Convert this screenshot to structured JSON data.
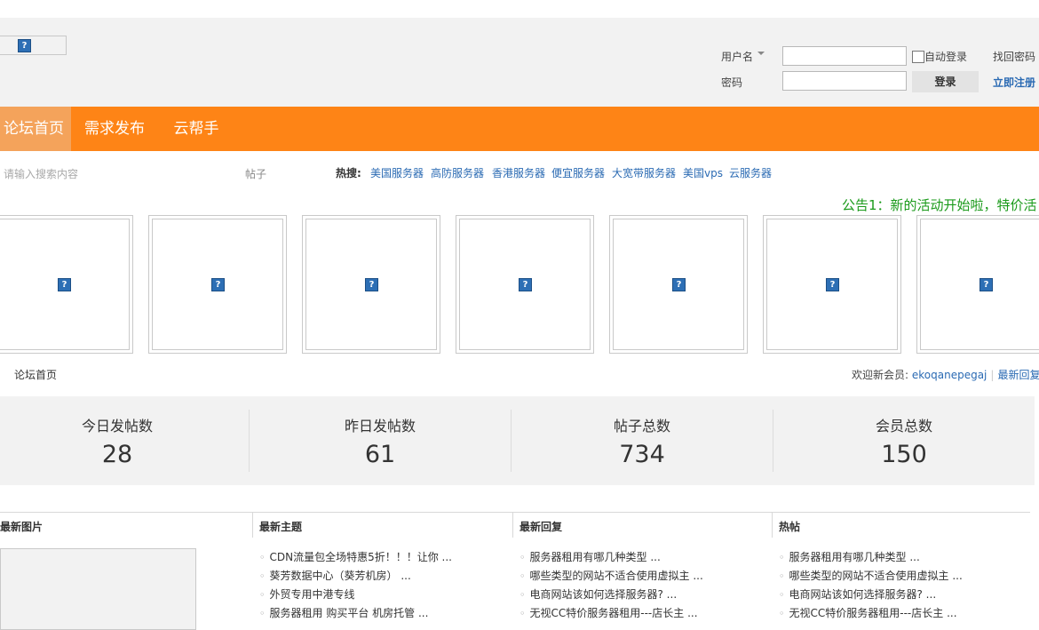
{
  "header": {
    "logo_icon": "broken-image-icon",
    "login": {
      "username_label": "用户名",
      "password_label": "密码",
      "username_value": "",
      "password_value": "",
      "auto_login_label": "自动登录",
      "find_password": "找回密码",
      "login_button": "登录",
      "register_link": "立即注册"
    }
  },
  "nav": {
    "items": [
      {
        "label": "论坛首页",
        "active": true
      },
      {
        "label": "需求发布",
        "active": false
      },
      {
        "label": "云帮手",
        "active": false
      }
    ],
    "accent": "#fe8416"
  },
  "search": {
    "placeholder": "请输入搜索内容",
    "type": "帖子",
    "hot_label": "热搜:",
    "hot_terms": [
      "美国服务器",
      "高防服务器",
      "香港服务器",
      "便宜服务器",
      "大宽带服务器",
      "美国vps",
      "云服务器"
    ]
  },
  "notice": {
    "text": "公告1：新的活动开始啦，特价活"
  },
  "banner_images": [
    "broken-image-icon",
    "broken-image-icon",
    "broken-image-icon",
    "broken-image-icon",
    "broken-image-icon",
    "broken-image-icon",
    "broken-image-icon"
  ],
  "breadcrumb": {
    "home": "论坛首页",
    "welcome_label": "欢迎新会员:",
    "new_member": "ekoqanepegaj",
    "latest_reply": "最新回复"
  },
  "stats": [
    {
      "title": "今日发帖数",
      "value": "28"
    },
    {
      "title": "昨日发帖数",
      "value": "61"
    },
    {
      "title": "帖子总数",
      "value": "734"
    },
    {
      "title": "会员总数",
      "value": "150"
    }
  ],
  "sections": {
    "latest_images": {
      "title": "最新图片"
    },
    "latest_topics": {
      "title": "最新主题",
      "items": [
        "CDN流量包全场特惠5折！！！让你 ...",
        "葵芳数据中心（葵芳机房） ...",
        "外贸专用中港专线",
        "服务器租用 购买平台 机房托管 ..."
      ]
    },
    "latest_replies": {
      "title": "最新回复",
      "items": [
        "服务器租用有哪几种类型 ...",
        "哪些类型的网站不适合使用虚拟主 ...",
        "电商网站该如何选择服务器? ...",
        "无视CC特价服务器租用---店长主 ..."
      ]
    },
    "hot_posts": {
      "title": "热帖",
      "items": [
        "服务器租用有哪几种类型 ...",
        "哪些类型的网站不适合使用虚拟主 ...",
        "电商网站该如何选择服务器? ...",
        "无视CC特价服务器租用---店长主 ..."
      ]
    }
  }
}
